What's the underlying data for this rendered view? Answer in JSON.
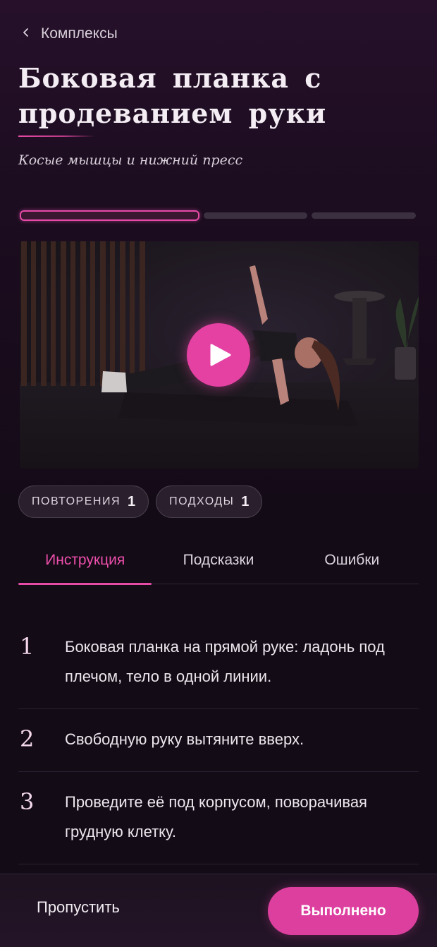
{
  "header": {
    "back_label": "Комплексы",
    "title": "Боковая планка с продеванием руки",
    "subtitle": "Косые мышцы и нижний пресс"
  },
  "progress": {
    "segments": 3,
    "active_index": 0
  },
  "video": {
    "icon": "play-icon",
    "accent": "#e441a3"
  },
  "stats": {
    "reps_label": "ПОВТОРЕНИЯ",
    "reps_value": "1",
    "sets_label": "ПОДХОДЫ",
    "sets_value": "1"
  },
  "tabs": [
    {
      "label": "Инструкция",
      "active": true
    },
    {
      "label": "Подсказки",
      "active": false
    },
    {
      "label": "Ошибки",
      "active": false
    }
  ],
  "steps": [
    {
      "num": "1",
      "text": "Боковая планка на прямой руке: ладонь под плечом, тело в одной линии."
    },
    {
      "num": "2",
      "text": "Свободную руку вытяните вверх."
    },
    {
      "num": "3",
      "text": "Проведите её под корпусом, поворачивая грудную клетку."
    }
  ],
  "actions": {
    "skip_label": "Пропустить",
    "done_label": "Выполнено"
  },
  "colors": {
    "accent": "#e64ba7",
    "background": "#130b16"
  }
}
